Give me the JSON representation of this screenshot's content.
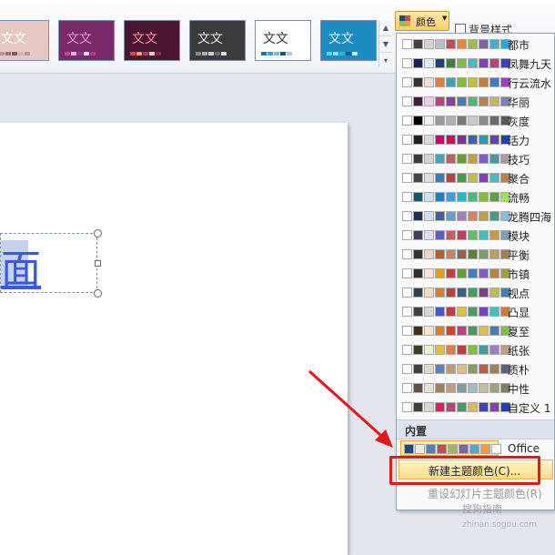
{
  "ribbon": {
    "themes": [
      {
        "text": "文文",
        "bg": "#e5c7c3",
        "fg": "#ffffff",
        "swatches": [
          "#c78f90",
          "#a86f70",
          "#8c5a5c",
          "#d9b3b1",
          "#b99695"
        ]
      },
      {
        "text": "文文",
        "bg": "#7a2a6a",
        "fg": "#e894d4",
        "swatches": [
          "#e03a8a",
          "#ffb0d8",
          "#7c3d8a",
          "#f4e3f0",
          "#c0307a"
        ]
      },
      {
        "text": "文文",
        "bg": "#4a1530",
        "fg": "#ff8da0",
        "swatches": [
          "#e0455a",
          "#ff9f6d",
          "#c03070",
          "#f7d0b0",
          "#8a2060"
        ]
      },
      {
        "text": "文文",
        "bg": "#3b3b3b",
        "fg": "#f0f0f0",
        "swatches": [
          "#8a8a8a",
          "#b0b0b0",
          "#d0d0d0",
          "#6a6a6a",
          "#e0e0e0"
        ]
      },
      {
        "text": "文文",
        "bg": "#ffffff",
        "fg": "#333333",
        "swatches": [
          "#1f6fb2",
          "#3fa0d0",
          "#6fc0e0",
          "#2f4f6f",
          "#9ad0e8"
        ]
      },
      {
        "text": "文文",
        "bg": "#1c8bbf",
        "fg": "#d8f4ff",
        "swatches": [
          "#5fd0f0",
          "#8fe0ff",
          "#2fb0e0",
          "#0e5f8f",
          "#bff0ff"
        ]
      }
    ],
    "colors_button": "颜色",
    "background_styles": "背景样式"
  },
  "slide": {
    "char": "面"
  },
  "menu": {
    "schemes": [
      {
        "name": "都市",
        "colors": [
          "#ffffff",
          "#424242",
          "#d4d4d4",
          "#b7c0c8",
          "#c0504d",
          "#e6873b",
          "#9bbb59",
          "#8064a2",
          "#4bacc6",
          "#27a8e0"
        ]
      },
      {
        "name": "凤舞九天",
        "colors": [
          "#ffffff",
          "#1f1f5f",
          "#ddebf7",
          "#1f3f7f",
          "#3f7f3f",
          "#7fbf3f",
          "#3fbfbf",
          "#7f3fbf",
          "#bf3f7f",
          "#3f3fbf"
        ]
      },
      {
        "name": "行云流水",
        "colors": [
          "#ffffff",
          "#333333",
          "#f2dfcf",
          "#e07f3f",
          "#3f9fbf",
          "#7fbf3f",
          "#bfbf3f",
          "#bf7f3f",
          "#3f7fbf",
          "#9f3fbf"
        ]
      },
      {
        "name": "华丽",
        "colors": [
          "#ffffff",
          "#3f1f3f",
          "#e8cfe8",
          "#bf3f7f",
          "#7f3fbf",
          "#3f7fbf",
          "#3fbf7f",
          "#bf7f3f",
          "#bfbf3f",
          "#7f7fbf"
        ]
      },
      {
        "name": "灰度",
        "colors": [
          "#ffffff",
          "#000000",
          "#f0f0f0",
          "#9a9a9a",
          "#b0b0b0",
          "#7a7a7a",
          "#cacaca",
          "#8a8a8a",
          "#6a6a6a",
          "#5a5a5a"
        ]
      },
      {
        "name": "活力",
        "colors": [
          "#ffffff",
          "#1f1f1f",
          "#dadada",
          "#d0006f",
          "#e0005f",
          "#7f2f9f",
          "#3f5fbf",
          "#1fa0c0",
          "#5f3fbf",
          "#1f3fbf"
        ]
      },
      {
        "name": "技巧",
        "colors": [
          "#ffffff",
          "#3b3b3b",
          "#d4d4d4",
          "#4f9fbf",
          "#bf5f5f",
          "#5f9f3f",
          "#bf9f3f",
          "#7f5fbf",
          "#3f9f9f",
          "#9f9f9f"
        ]
      },
      {
        "name": "聚合",
        "colors": [
          "#ffffff",
          "#444444",
          "#e0e0e0",
          "#2f7fbf",
          "#bf3f3f",
          "#3f9f3f",
          "#bfbf3f",
          "#7f3fbf",
          "#3fbfbf",
          "#bf7f3f"
        ]
      },
      {
        "name": "流畅",
        "colors": [
          "#ffffff",
          "#1f4f6f",
          "#d0e4f0",
          "#1f7fbf",
          "#3f9fdf",
          "#1fbfbf",
          "#3fbf7f",
          "#7fbf3f",
          "#5f9f3f",
          "#9fdf5f"
        ]
      },
      {
        "name": "龙腾四海",
        "colors": [
          "#ffffff",
          "#1f2f4f",
          "#d0e0f0",
          "#3f5f9f",
          "#5f9fdf",
          "#9f7fbf",
          "#df7f5f",
          "#bf9f3f",
          "#3f9f7f",
          "#7fbfdf"
        ]
      },
      {
        "name": "模块",
        "colors": [
          "#ffffff",
          "#3f3f5f",
          "#e0e0ec",
          "#5f5fbf",
          "#bf5f5f",
          "#bf3f5f",
          "#5fbf5f",
          "#3fbfbf",
          "#bf9f3f",
          "#7f9fbf"
        ]
      },
      {
        "name": "平衡",
        "colors": [
          "#ffffff",
          "#333333",
          "#e8d8c8",
          "#bf5f1f",
          "#df7f3f",
          "#9f5f3f",
          "#5f7f3f",
          "#7f9f5f",
          "#bf9f5f",
          "#9f7f5f"
        ]
      },
      {
        "name": "市镇",
        "colors": [
          "#ffffff",
          "#2f2f2f",
          "#f0e8d0",
          "#df9f1f",
          "#bf3f3f",
          "#5f9f3f",
          "#3f7fbf",
          "#7f5fbf",
          "#bf7f3f",
          "#9f9f3f"
        ]
      },
      {
        "name": "视点",
        "colors": [
          "#ffffff",
          "#2f3f4f",
          "#f0e0c0",
          "#df7f1f",
          "#bf3f3f",
          "#3f5f7f",
          "#3f9f5f",
          "#7f3f7f",
          "#bfbf3f",
          "#3f7fbf"
        ]
      },
      {
        "name": "凸显",
        "colors": [
          "#ffffff",
          "#3f3f3f",
          "#d8d8d8",
          "#3f5fbf",
          "#bf3f3f",
          "#dfbf3f",
          "#3f9f5f",
          "#7f3fbf",
          "#3fbfbf",
          "#bf7f3f"
        ]
      },
      {
        "name": "夏至",
        "colors": [
          "#ffffff",
          "#3f2f1f",
          "#f8e8c8",
          "#df7f1f",
          "#df3f1f",
          "#bf3f7f",
          "#3f9f5f",
          "#dfbf3f",
          "#3f7fbf",
          "#7fbf3f"
        ]
      },
      {
        "name": "纸张",
        "colors": [
          "#ffffff",
          "#3f3f1f",
          "#f0f0d0",
          "#dfbf3f",
          "#df7f3f",
          "#bf3f3f",
          "#7fbf3f",
          "#3f9f9f",
          "#9f7fbf",
          "#bf9f7f"
        ]
      },
      {
        "name": "质朴",
        "colors": [
          "#ffffff",
          "#3f3f3f",
          "#e0d8c8",
          "#5f7fbf",
          "#bf9f5f",
          "#dfbf7f",
          "#7f9f5f",
          "#bf5f3f",
          "#9f7f5f",
          "#5f5f7f"
        ]
      },
      {
        "name": "中性",
        "colors": [
          "#ffffff",
          "#5f4f3f",
          "#e8e0d0",
          "#9f7f5f",
          "#bf9f7f",
          "#7f9f9f",
          "#9fbfbf",
          "#bfbf9f",
          "#9f9f7f",
          "#7f7f5f"
        ]
      },
      {
        "name": "自定义 1",
        "colors": [
          "#ffffff",
          "#3f3f3f",
          "#d8d8d8",
          "#df1f5f",
          "#bf3f7f",
          "#3f9f5f",
          "#dfbf3f",
          "#3f3fbf",
          "#7f3fbf",
          "#1f3fbf"
        ]
      }
    ],
    "section_label": "内置",
    "builtin": {
      "name": "Office",
      "colors": [
        "#1f497d",
        "#eeece1",
        "#4f81bd",
        "#c0504d",
        "#9bbb59",
        "#8064a2",
        "#4bacc6",
        "#f79646",
        "#ffffff"
      ]
    },
    "new_theme_colors": "新建主题颜色(C)...",
    "reset_theme_colors": "重设幻灯片主题颜色(R)"
  },
  "watermark": {
    "line1": "搜狗指南",
    "line2": "zhinan.sogou.com"
  },
  "accent": {
    "highlight": "#e5171c",
    "hover": "#fddc86"
  }
}
